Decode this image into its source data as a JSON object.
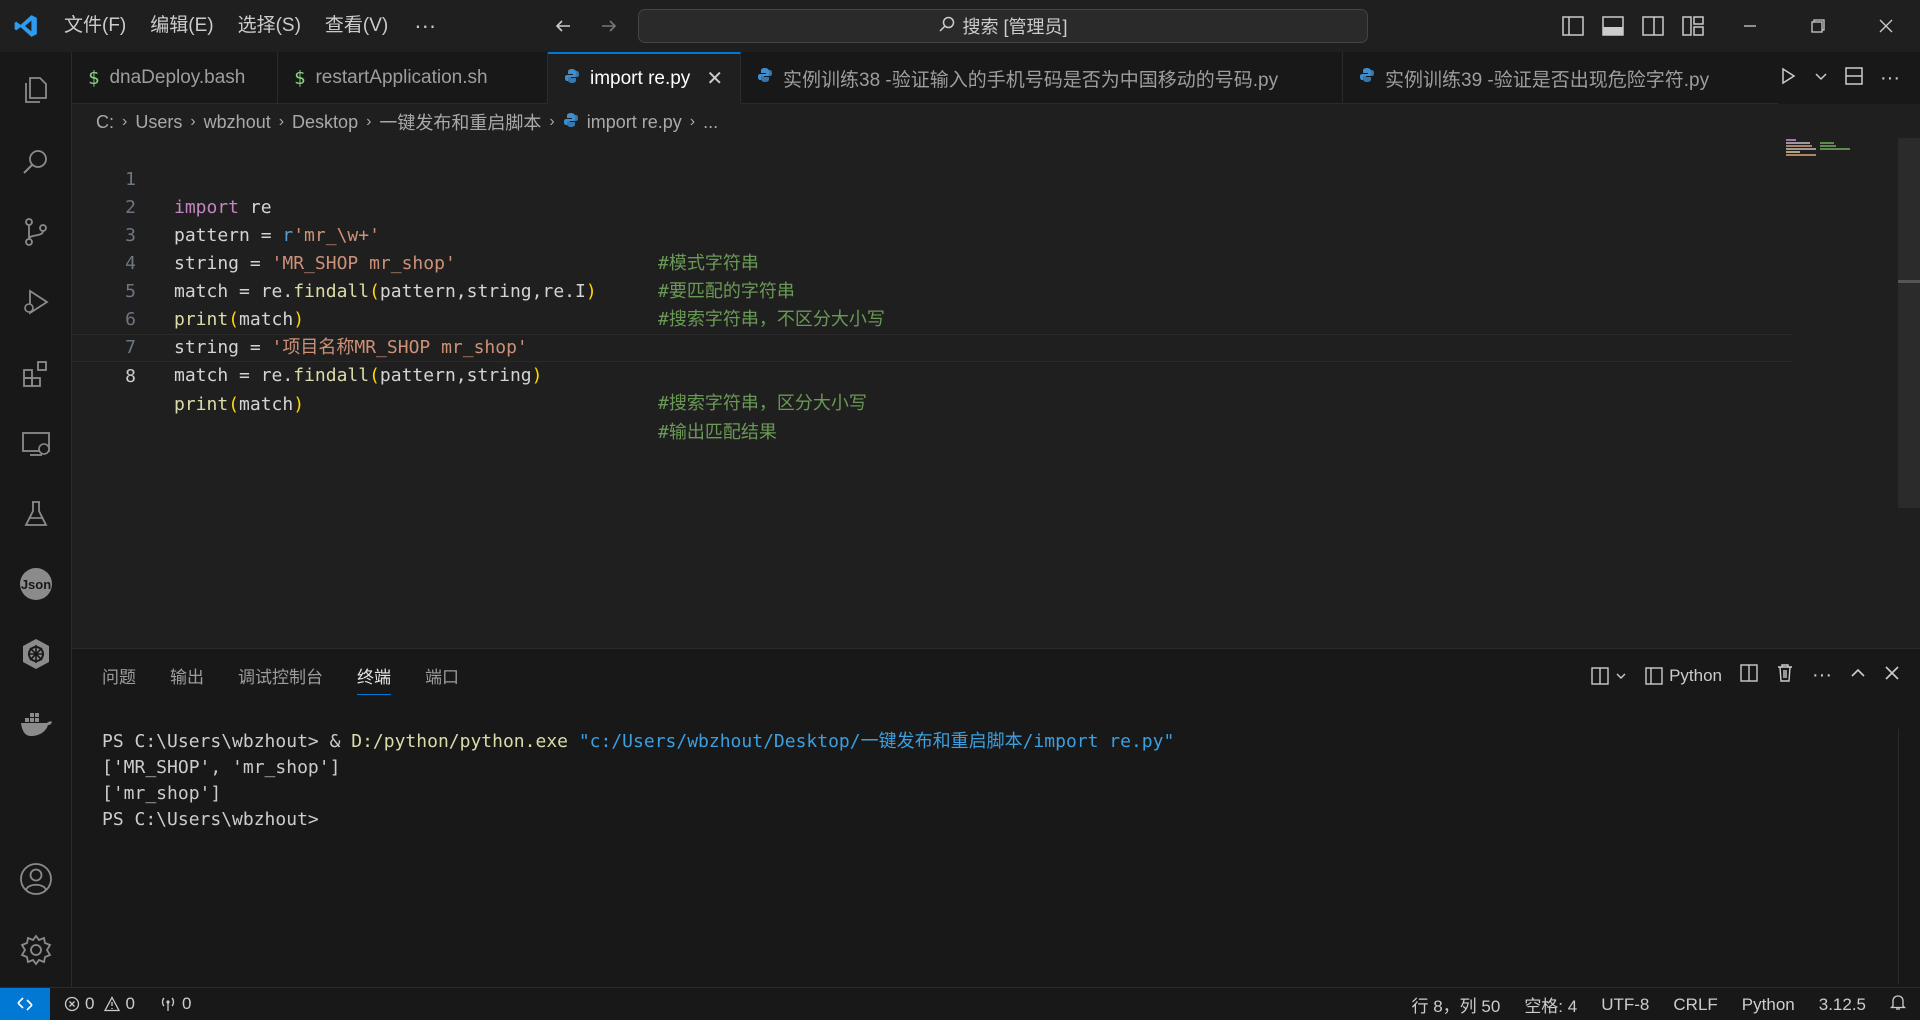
{
  "menu": [
    "文件(F)",
    "编辑(E)",
    "选择(S)",
    "查看(V)"
  ],
  "menu_more": "···",
  "search": {
    "label": "搜索 [管理员]"
  },
  "tabs": [
    {
      "label": "dnaDeploy.bash",
      "icon": "dollar-icon"
    },
    {
      "label": "restartApplication.sh",
      "icon": "dollar-icon"
    },
    {
      "label": "import re.py",
      "icon": "python-icon",
      "active": true
    },
    {
      "label": "实例训练38 -验证输入的手机号码是否为中国移动的号码.py",
      "icon": "python-icon"
    },
    {
      "label": "实例训练39 -验证是否出现危险字符.py",
      "icon": "python-icon"
    }
  ],
  "breadcrumb": [
    "C:",
    "Users",
    "wbzhout",
    "Desktop",
    "一键发布和重启脚本",
    "import re.py",
    "..."
  ],
  "editor": {
    "line_numbers": [
      "1",
      "2",
      "3",
      "4",
      "5",
      "6",
      "7",
      "8"
    ],
    "lines": [
      {
        "kw": "import",
        "rest": " re",
        "comment": ""
      },
      {
        "a": "pattern = ",
        "pre": "r",
        "str": "'mr_\\w+'",
        "comment": "#模式字符串"
      },
      {
        "a": "string = ",
        "str": "'MR_SHOP mr_shop'",
        "comment": "#要匹配的字符串"
      },
      {
        "a": "match = re.",
        "fn": "findall",
        "args": "pattern,string,re.I",
        "comment": "#搜索字符串，不区分大小写"
      },
      {
        "fn": "print",
        "args": "match",
        "comment": ""
      },
      {
        "a": "string = ",
        "str": "'项目名称MR_SHOP mr_shop'",
        "comment": ""
      },
      {
        "a": "match = re.",
        "fn": "findall",
        "args": "pattern,string",
        "comment": "#搜索字符串，区分大小写"
      },
      {
        "fn": "print",
        "args": "match",
        "comment": "#输出匹配结果"
      }
    ]
  },
  "panel": {
    "tabs": [
      "问题",
      "输出",
      "调试控制台",
      "终端",
      "端口"
    ],
    "active_tab": "终端",
    "shell_label": "Python"
  },
  "terminal": {
    "line1_prompt": "PS C:\\Users\\wbzhout> & ",
    "line1_exe": "D:/python/python.exe",
    "line1_arg": " \"c:/Users/wbzhout/Desktop/一键发布和重启脚本/import re.py\"",
    "line2": "['MR_SHOP', 'mr_shop']",
    "line3": "['mr_shop']",
    "line4": "PS C:\\Users\\wbzhout>"
  },
  "status": {
    "errors": "0",
    "warnings": "0",
    "ports": "0",
    "position": "行 8，列 50",
    "spaces": "空格: 4",
    "encoding": "UTF-8",
    "eol": "CRLF",
    "language": "Python",
    "version": "3.12.5"
  },
  "colors": {
    "accent": "#0078d4",
    "bg": "#1f1f1f",
    "comment": "#6a9955",
    "string": "#ce9178"
  }
}
